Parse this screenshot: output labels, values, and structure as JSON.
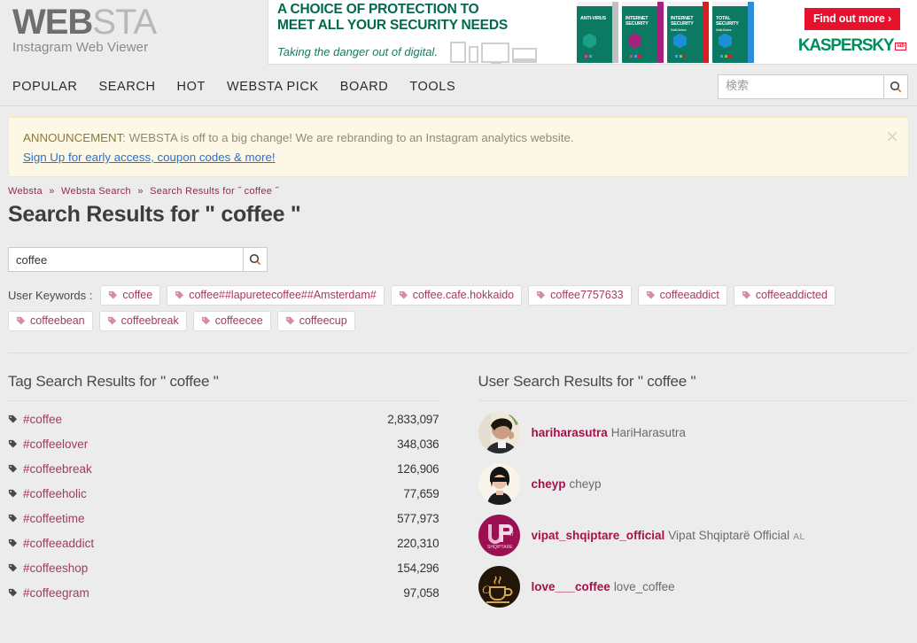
{
  "brand": {
    "logo_bold": "WEB",
    "logo_light": "STA",
    "tagline": "Instagram Web Viewer"
  },
  "ad": {
    "headline_line1": "A CHOICE OF PROTECTION TO",
    "headline_line2": "MEET ALL YOUR SECURITY NEEDS",
    "tagline": "Taking the danger out of digital.",
    "cta": "Find out more ›",
    "brand": "KASPERSKY",
    "brand_mark": "lab",
    "products": [
      {
        "title": "ANTI-VIRUS",
        "sub": "",
        "spine": "#c0c0c0"
      },
      {
        "title": "INTERNET SECURITY",
        "sub": "",
        "spine": "#a4227d"
      },
      {
        "title": "INTERNET SECURITY",
        "sub": "Multi-Device",
        "spine": "#d81f26"
      },
      {
        "title": "TOTAL SECURITY",
        "sub": "Multi-Device",
        "spine": "#2b8fd6"
      }
    ]
  },
  "nav": {
    "items": [
      {
        "label": "POPULAR"
      },
      {
        "label": "SEARCH"
      },
      {
        "label": "HOT"
      },
      {
        "label": "WEBSTA PICK"
      },
      {
        "label": "BOARD"
      },
      {
        "label": "TOOLS"
      }
    ],
    "search_placeholder": "検索",
    "search_value": ""
  },
  "announcement": {
    "label": "ANNOUNCEMENT",
    "text": ": WEBSTA is off to a big change! We are rebranding to an Instagram analytics website.",
    "link": "Sign Up for early access, coupon codes & more!",
    "close": "×"
  },
  "breadcrumb": {
    "items": [
      "Websta",
      "Websta Search",
      "Search Results for ˝ coffee ˝"
    ],
    "separator": "»"
  },
  "page": {
    "title": "Search Results for \" coffee \"",
    "search_value": "coffee",
    "search_placeholder": ""
  },
  "keywords": {
    "label": "User Keywords :",
    "items": [
      "coffee",
      "coffee##lapuretecoffee##Amsterdam#",
      "coffee.cafe.hokkaido",
      "coffee7757633",
      "coffeeaddict",
      "coffeeaddicted",
      "coffeebean",
      "coffeebreak",
      "coffeecee",
      "coffeecup"
    ]
  },
  "tag_results": {
    "heading": "Tag Search Results for \" coffee \"",
    "rows": [
      {
        "tag": "#coffee",
        "count": "2,833,097"
      },
      {
        "tag": "#coffeelover",
        "count": "348,036"
      },
      {
        "tag": "#coffeebreak",
        "count": "126,906"
      },
      {
        "tag": "#coffeeholic",
        "count": "77,659"
      },
      {
        "tag": "#coffeetime",
        "count": "577,973"
      },
      {
        "tag": "#coffeeaddict",
        "count": "220,310"
      },
      {
        "tag": "#coffeeshop",
        "count": "154,296"
      },
      {
        "tag": "#coffeegram",
        "count": "97,058"
      }
    ]
  },
  "user_results": {
    "heading": "User Search Results for \" coffee \"",
    "rows": [
      {
        "username": "hariharasutra",
        "fullname": "HariHarasutra",
        "country": "",
        "avatar_colors": [
          "#e8e0d2",
          "#2b2018"
        ]
      },
      {
        "username": "cheyp",
        "fullname": "cheyp",
        "country": "",
        "avatar_colors": [
          "#f7f1e8",
          "#1c1c1c"
        ]
      },
      {
        "username": "vipat_shqiptare_official",
        "fullname": "Vipat Shqiptarë Official",
        "country": "AL",
        "avatar_colors": [
          "#9c0f52",
          "#d080a8"
        ]
      },
      {
        "username": "love___coffee",
        "fullname": "love_coffee",
        "country": "",
        "avatar_colors": [
          "#241609",
          "#d7a94f"
        ]
      }
    ]
  },
  "colors": {
    "page_bg": "#ececec",
    "accent_maroon": "#a33a5e",
    "link_blue": "#2a6fd4",
    "announce_bg": "#fdf8e5",
    "kaspersky_green": "#008e5b",
    "kaspersky_red": "#e8112d"
  }
}
